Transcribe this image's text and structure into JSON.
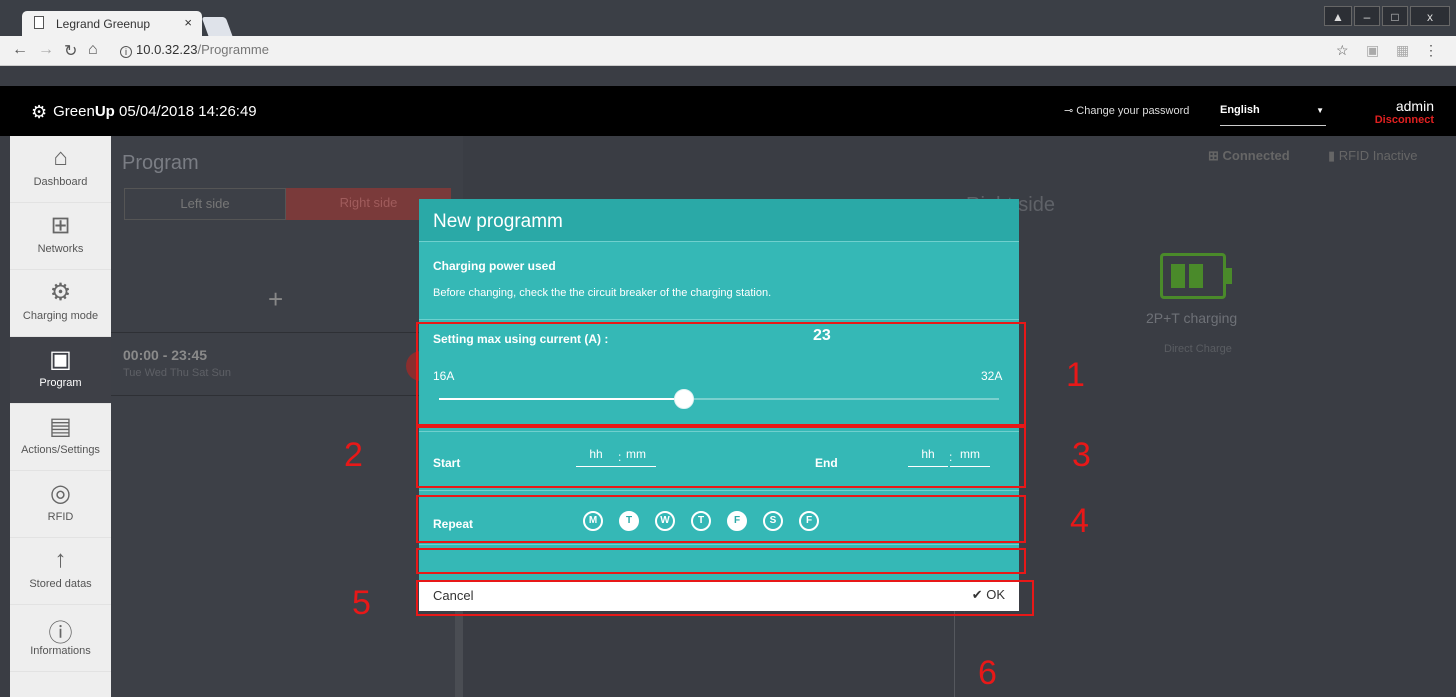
{
  "browser": {
    "tab_title": "Legrand Greenup",
    "tab_close": "×",
    "url_host": "10.0.32.23",
    "url_path": "/Programme",
    "info_glyph": "i",
    "window_controls": [
      "▲",
      "–",
      "□",
      "x"
    ]
  },
  "header": {
    "brand_prefix": "Green",
    "brand_bold": "Up",
    "datetime": "05/04/2018 14:26:49",
    "change_password": "Change your password",
    "language": "English",
    "user": "admin",
    "disconnect": "Disconnect"
  },
  "sidebar": {
    "items": [
      {
        "label": "Dashboard",
        "icon": "house-icon",
        "glyph": "⌂"
      },
      {
        "label": "Networks",
        "icon": "network-icon",
        "glyph": "⊞"
      },
      {
        "label": "Charging mode",
        "icon": "gear-outline-icon",
        "glyph": "⚙"
      },
      {
        "label": "Program",
        "icon": "calendar-icon",
        "glyph": "▣",
        "active": true
      },
      {
        "label": "Actions/Settings",
        "icon": "clipboard-icon",
        "glyph": "▤"
      },
      {
        "label": "RFID",
        "icon": "rfid-icon",
        "glyph": "◎"
      },
      {
        "label": "Stored datas",
        "icon": "upload-icon",
        "glyph": "↑"
      },
      {
        "label": "Informations",
        "icon": "info-icon",
        "glyph": "ⓘ"
      }
    ]
  },
  "background": {
    "program_title": "Program",
    "left_side": "Left side",
    "right_side": "Right side",
    "add": "+",
    "slot_time": "00:00 - 23:45",
    "slot_days": "Tue Wed Thu Sat Sun",
    "connected": "Connected",
    "rfid": "RFID Inactive",
    "right_side_heading": "Right side",
    "charging_type": "2P+T charging",
    "charge_mode": "Direct Charge"
  },
  "modal": {
    "title": "New programm",
    "power_heading": "Charging power used",
    "power_desc": "Before changing, check the the circuit breaker of the charging station.",
    "current_label": "Setting max using current (A) :",
    "current_value": "23",
    "min_label": "16A",
    "max_label": "32A",
    "slider_min": 16,
    "slider_max": 32,
    "slider_value": 23,
    "start_label": "Start",
    "end_label": "End",
    "hh_placeholder": "hh",
    "mm_placeholder": "mm",
    "time_separator": ":",
    "repeat_label": "Repeat",
    "days": [
      {
        "letter": "M",
        "selected": false
      },
      {
        "letter": "T",
        "selected": true
      },
      {
        "letter": "W",
        "selected": false
      },
      {
        "letter": "T",
        "selected": false
      },
      {
        "letter": "F",
        "selected": true
      },
      {
        "letter": "S",
        "selected": false
      },
      {
        "letter": "F",
        "selected": false
      }
    ],
    "cancel": "Cancel",
    "ok": "✔ OK"
  },
  "annotations": [
    "1",
    "2",
    "3",
    "4",
    "5",
    "6"
  ],
  "colors": {
    "teal": "#35b8b6",
    "annotation_red": "#e81818",
    "disconnect_red": "#e02020"
  }
}
